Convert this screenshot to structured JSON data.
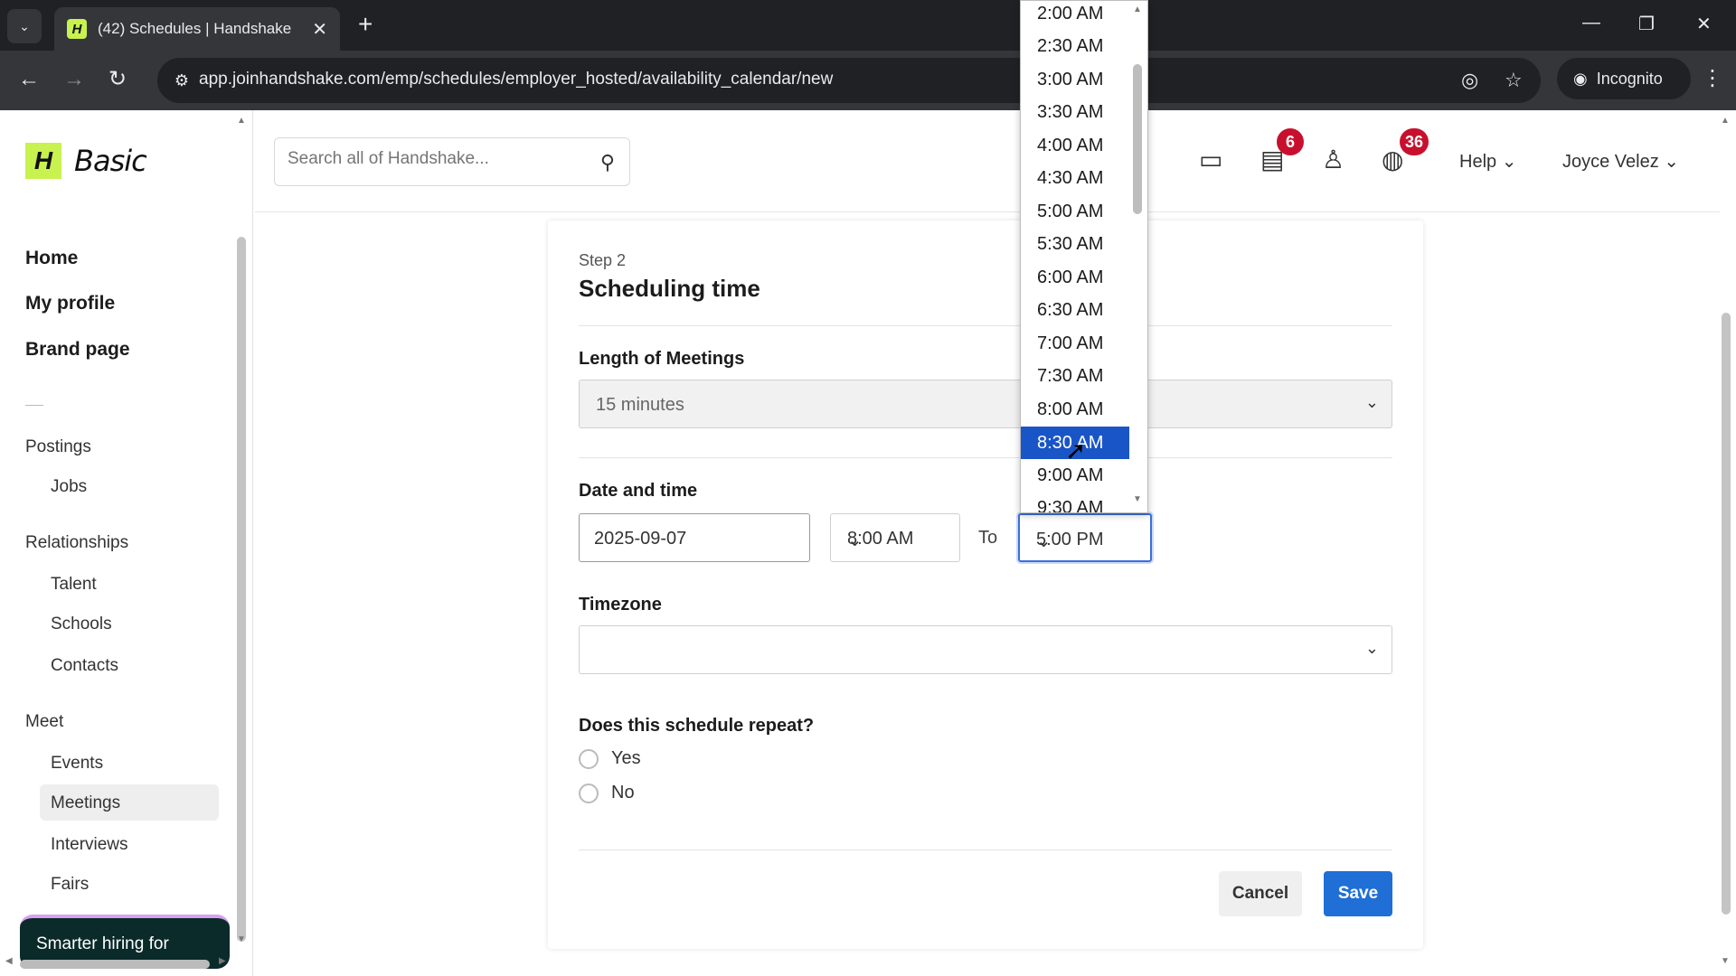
{
  "browser": {
    "tab_title": "(42) Schedules | Handshake",
    "url": "app.joinhandshake.com/emp/schedules/employer_hosted/availability_calendar/new",
    "incognito_label": "Incognito"
  },
  "sidebar": {
    "logo_text": "Basic",
    "main_items": [
      "Home",
      "My profile",
      "Brand page"
    ],
    "groups": [
      {
        "label": "Postings",
        "items": [
          "Jobs"
        ]
      },
      {
        "label": "Relationships",
        "items": [
          "Talent",
          "Schools",
          "Contacts"
        ]
      },
      {
        "label": "Meet",
        "items": [
          "Events",
          "Meetings",
          "Interviews",
          "Fairs"
        ]
      }
    ],
    "active_item": "Meetings",
    "promo_text": "Smarter hiring for"
  },
  "header": {
    "search_placeholder": "Search all of Handshake...",
    "messages_badge": "6",
    "notifications_badge": "36",
    "help_label": "Help",
    "user_name": "Joyce Velez"
  },
  "form": {
    "step": "Step 2",
    "title": "Scheduling time",
    "length_label": "Length of Meetings",
    "length_value": "15 minutes",
    "datetime_label": "Date and time",
    "date_value": "2025-09-07",
    "start_time": "8:00 AM",
    "to_label": "To",
    "end_time": "5:00 PM",
    "timezone_label": "Timezone",
    "timezone_value": "",
    "repeat_label": "Does this schedule repeat?",
    "repeat_options": [
      "Yes",
      "No"
    ],
    "cancel_label": "Cancel",
    "save_label": "Save"
  },
  "dropdown": {
    "options": [
      "2:00 AM",
      "2:30 AM",
      "3:00 AM",
      "3:30 AM",
      "4:00 AM",
      "4:30 AM",
      "5:00 AM",
      "5:30 AM",
      "6:00 AM",
      "6:30 AM",
      "7:00 AM",
      "7:30 AM",
      "8:00 AM",
      "8:30 AM",
      "9:00 AM",
      "9:30 AM"
    ],
    "highlighted": "8:30 AM"
  },
  "colors": {
    "brand": "#c7f250",
    "primary": "#1f6fd6",
    "badge": "#c8102e",
    "highlight": "#1a55c7"
  }
}
